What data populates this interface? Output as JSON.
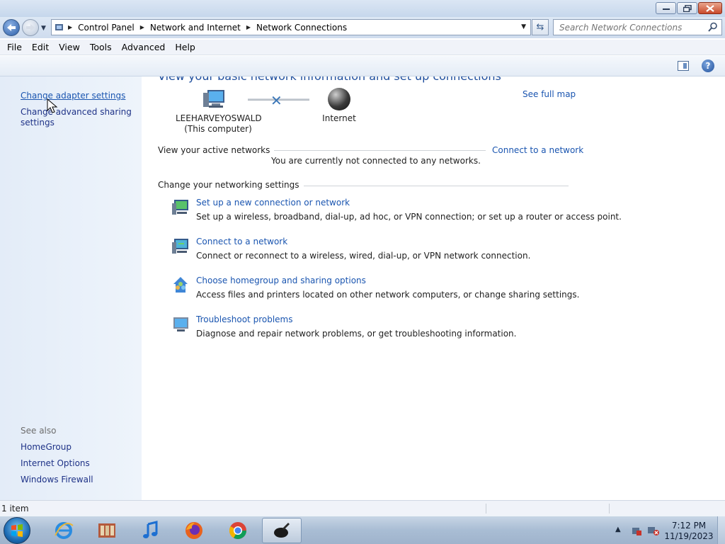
{
  "window": {
    "controls": {
      "minimize": "minimize",
      "maximize": "maximize",
      "close": "close"
    }
  },
  "address": {
    "crumbs": [
      "Control Panel",
      "Network and Internet",
      "Network Connections"
    ],
    "search_placeholder": "Search Network Connections"
  },
  "menu": [
    "File",
    "Edit",
    "View",
    "Tools",
    "Advanced",
    "Help"
  ],
  "sidebar": {
    "tasks": [
      "Change adapter settings",
      "Change advanced sharing settings"
    ],
    "see_also_label": "See also",
    "see_also": [
      "HomeGroup",
      "Internet Options",
      "Windows Firewall"
    ]
  },
  "main": {
    "heading": "View your basic network information and set up connections",
    "see_full_map": "See full map",
    "computer_name": "LEEHARVEYOSWALD",
    "computer_sub": "(This computer)",
    "internet_label": "Internet",
    "active_networks_label": "View your active networks",
    "connect_link": "Connect to a network",
    "not_connected": "You are currently not connected to any networks.",
    "settings_label": "Change your networking settings",
    "tasks": [
      {
        "title": "Set up a new connection or network",
        "desc": "Set up a wireless, broadband, dial-up, ad hoc, or VPN connection; or set up a router or access point.",
        "icon": "network-setup-icon"
      },
      {
        "title": "Connect to a network",
        "desc": "Connect or reconnect to a wireless, wired, dial-up, or VPN network connection.",
        "icon": "connect-network-icon"
      },
      {
        "title": "Choose homegroup and sharing options",
        "desc": "Access files and printers located on other network computers, or change sharing settings.",
        "icon": "homegroup-icon"
      },
      {
        "title": "Troubleshoot problems",
        "desc": "Diagnose and repair network problems, or get troubleshooting information.",
        "icon": "troubleshoot-icon"
      }
    ]
  },
  "status": {
    "items": "1 item"
  },
  "taskbar": {
    "apps": [
      "internet-explorer-icon",
      "windows-explorer-icon",
      "media-player-icon",
      "firefox-icon",
      "chrome-icon",
      "app-icon"
    ],
    "time": "7:12 PM",
    "date": "11/19/2023"
  },
  "colors": {
    "link": "#1a55b0",
    "heading": "#1e4e9d",
    "sidebar": "#e3ecf8"
  }
}
